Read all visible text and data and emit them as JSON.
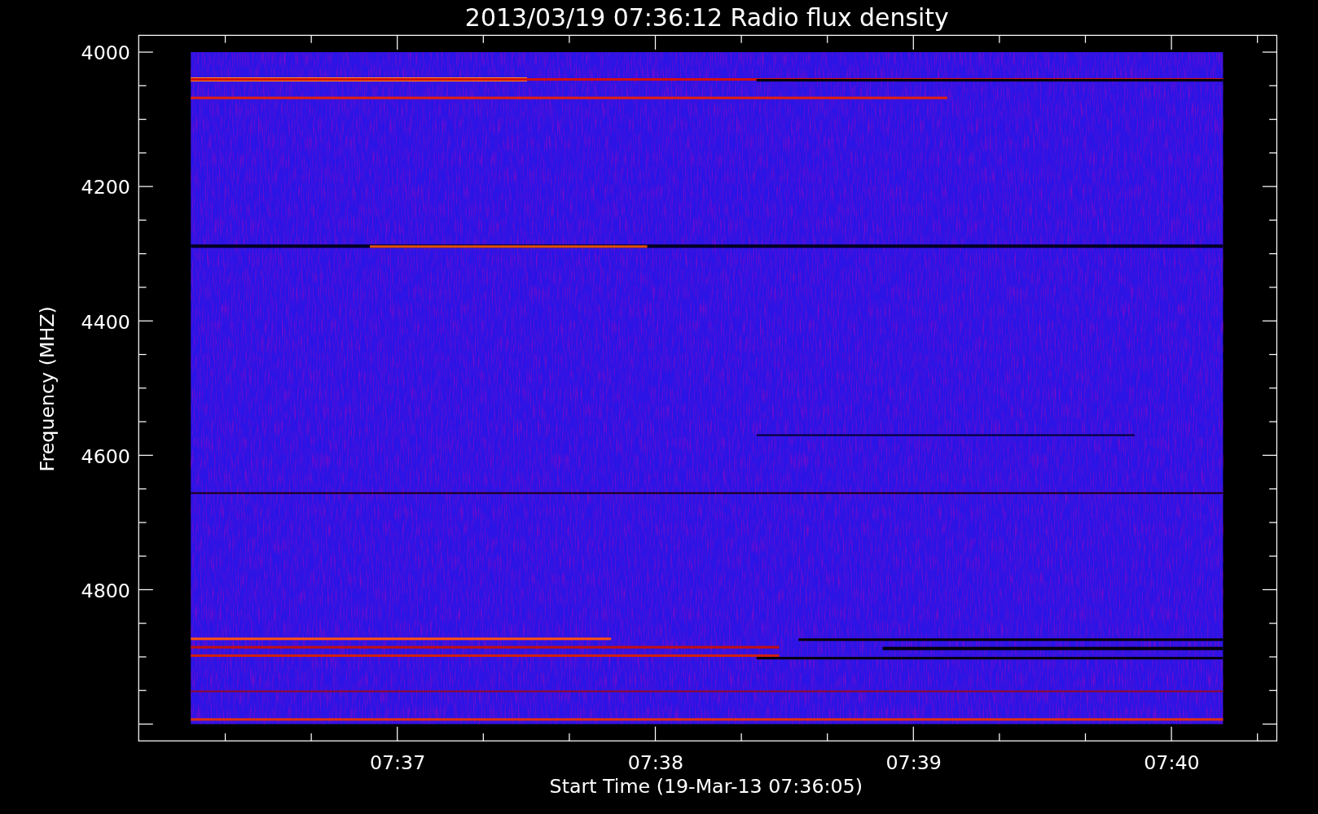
{
  "title": "2013/03/19 07:36:12 Radio flux density",
  "y_axis": {
    "label": "Frequency (MHZ)",
    "ticks": [
      "4000",
      "4200",
      "4400",
      "4600",
      "4800"
    ]
  },
  "x_axis": {
    "label": "Start Time (19-Mar-13 07:36:05)",
    "ticks": [
      "07:37",
      "07:38",
      "07:39",
      "07:40"
    ]
  }
}
